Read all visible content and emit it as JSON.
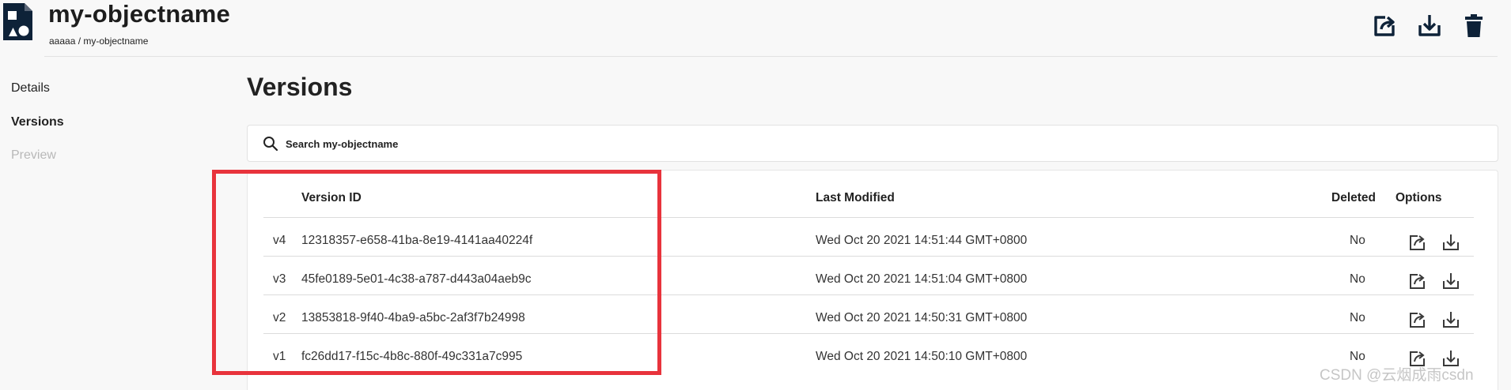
{
  "header": {
    "title": "my-objectname",
    "breadcrumb": "aaaaa / my-objectname",
    "icon": "object-file-icon",
    "actions": [
      {
        "name": "share",
        "icon": "share-icon"
      },
      {
        "name": "download",
        "icon": "download-icon"
      },
      {
        "name": "delete",
        "icon": "trash-icon"
      }
    ]
  },
  "sidebar": {
    "items": [
      {
        "label": "Details",
        "state": "normal"
      },
      {
        "label": "Versions",
        "state": "active"
      },
      {
        "label": "Preview",
        "state": "disabled"
      }
    ]
  },
  "main": {
    "title": "Versions",
    "search": {
      "placeholder": "Search my-objectname",
      "value": ""
    },
    "table": {
      "columns": {
        "version_id": "Version ID",
        "last_modified": "Last Modified",
        "deleted": "Deleted",
        "options": "Options"
      },
      "rows": [
        {
          "tag": "v4",
          "version_id": "12318357-e658-41ba-8e19-4141aa40224f",
          "last_modified": "Wed Oct 20 2021 14:51:44 GMT+0800",
          "deleted": "No"
        },
        {
          "tag": "v3",
          "version_id": "45fe0189-5e01-4c38-a787-d443a04aeb9c",
          "last_modified": "Wed Oct 20 2021 14:51:04 GMT+0800",
          "deleted": "No"
        },
        {
          "tag": "v2",
          "version_id": "13853818-9f40-4ba9-a5bc-2af3f7b24998",
          "last_modified": "Wed Oct 20 2021 14:50:31 GMT+0800",
          "deleted": "No"
        },
        {
          "tag": "v1",
          "version_id": "fc26dd17-f15c-4b8c-880f-49c331a7c995",
          "last_modified": "Wed Oct 20 2021 14:50:10 GMT+0800",
          "deleted": "No"
        }
      ]
    }
  },
  "watermark": "CSDN @云烟成雨csdn",
  "colors": {
    "highlight_box": "#e8333c",
    "icon": "#0e2238"
  }
}
